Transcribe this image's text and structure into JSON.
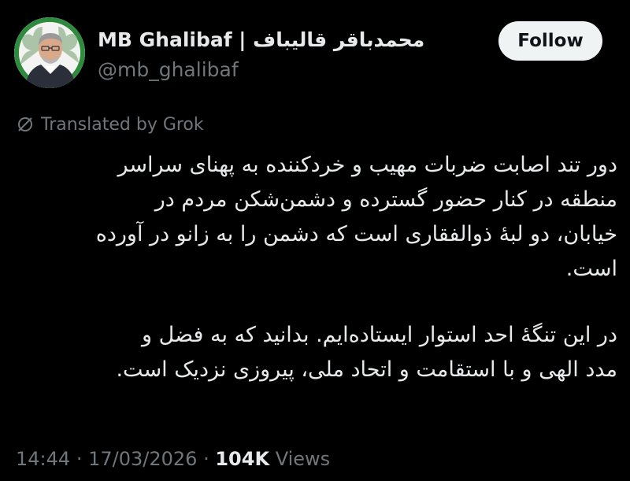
{
  "author": {
    "display_name": "MB Ghalibaf | محمدباقر قالیباف",
    "handle": "@mb_ghalibaf"
  },
  "follow_label": "Follow",
  "translation_label": "Translated by Grok",
  "tweet": {
    "paragraph_1": [
      "دور تند اصابت ضربات مهیب و خردکننده به پهنای سراسر",
      "منطقه در کنار حضور گسترده و دشمن‌شکن مردم در",
      "خیابان، دو لبۀ ذوالفقاری است که دشمن را به زانو در آورده",
      "است."
    ],
    "paragraph_2": [
      "در این تنگۀ احد استوار ایستاده‌ایم. بدانید که به فضل و",
      "مدد الهی و با استقامت و اتحاد ملی، پیروزی نزدیک است."
    ]
  },
  "meta": {
    "time": "14:44",
    "separator": "·",
    "date": "17/03/2026",
    "views_count": "104K",
    "views_label": "Views"
  },
  "colors": {
    "background": "#000000",
    "primary_text": "#e7e9ea",
    "secondary_text": "#71767b",
    "follow_bg": "#eff3f4",
    "follow_text": "#0f1419"
  },
  "icons": {
    "translation": "translate-slash-icon"
  }
}
